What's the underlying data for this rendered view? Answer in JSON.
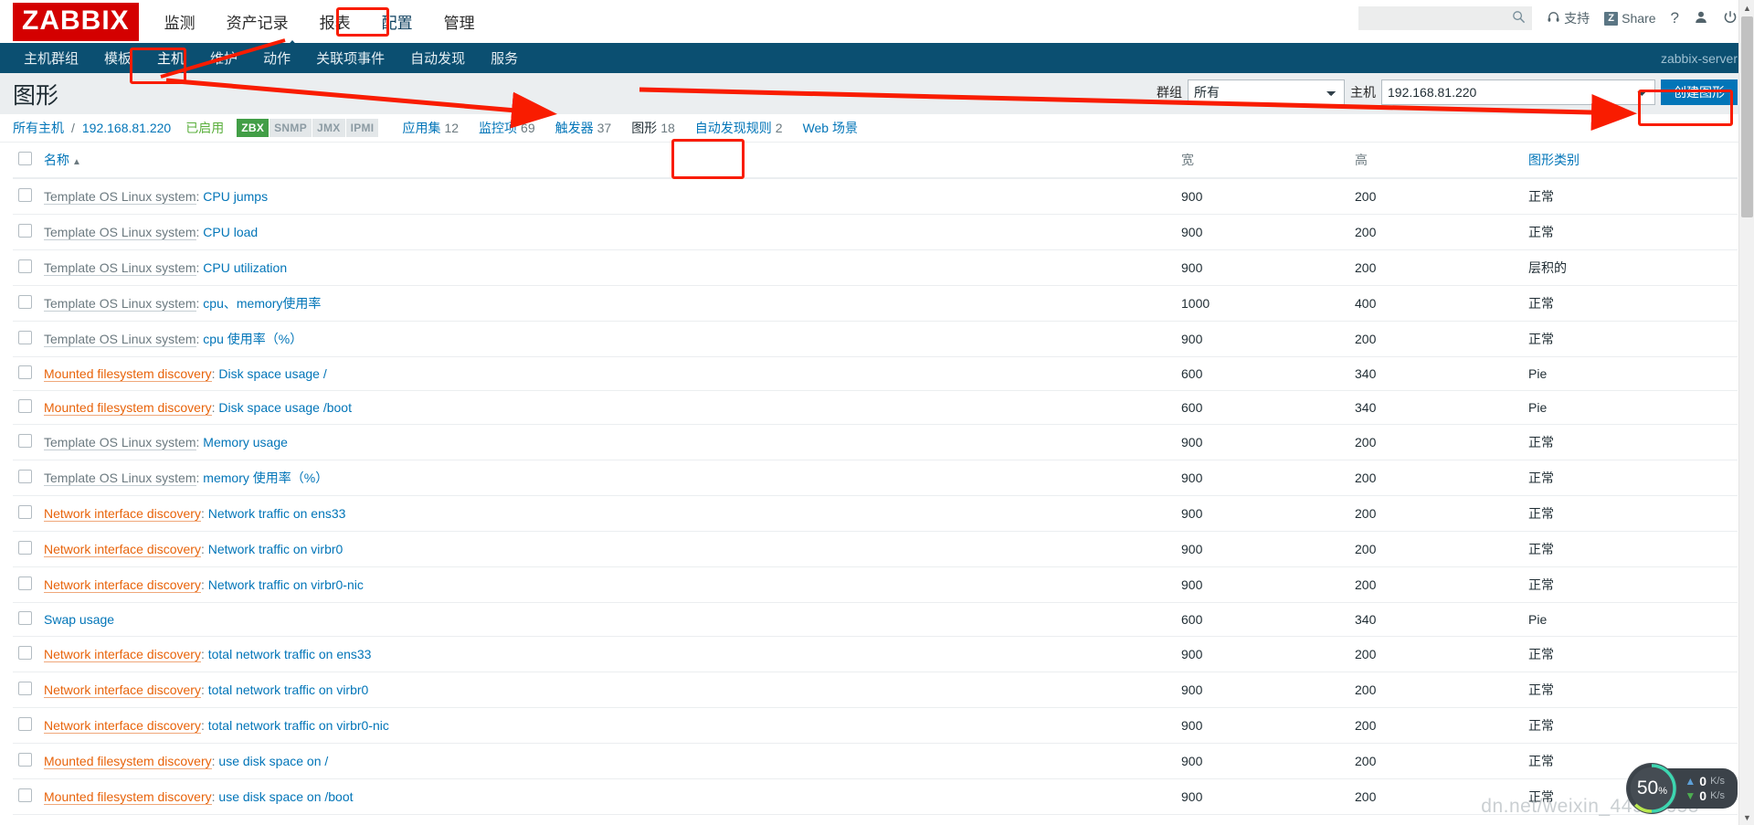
{
  "brand": {
    "logo": "ZABBIX"
  },
  "main_nav": {
    "items": [
      {
        "label": "监测",
        "active": false
      },
      {
        "label": "资产记录",
        "active": false
      },
      {
        "label": "报表",
        "active": false
      },
      {
        "label": "配置",
        "active": true
      },
      {
        "label": "管理",
        "active": false
      }
    ]
  },
  "header_right": {
    "search_placeholder": "",
    "search_value": "",
    "search_icon": "search-icon",
    "support_label": "支持",
    "support_icon": "headset-icon",
    "share_label": "Share",
    "share_badge": "Z",
    "help_icon": "?",
    "user_icon": "user-icon",
    "power_icon": "power-icon"
  },
  "sub_nav": {
    "items": [
      {
        "label": "主机群组",
        "active": false
      },
      {
        "label": "模板",
        "active": false
      },
      {
        "label": "主机",
        "active": true
      },
      {
        "label": "维护",
        "active": false
      },
      {
        "label": "动作",
        "active": false
      },
      {
        "label": "关联项事件",
        "active": false
      },
      {
        "label": "自动发现",
        "active": false
      },
      {
        "label": "服务",
        "active": false
      }
    ],
    "server_label": "zabbix-server"
  },
  "page": {
    "title": "图形"
  },
  "filters": {
    "group_label": "群组",
    "group_value": "所有",
    "host_label": "主机",
    "host_value": "192.168.81.220",
    "create_button": "创建图形"
  },
  "breadcrumb": {
    "all_hosts": "所有主机",
    "separator": "/",
    "host": "192.168.81.220",
    "status": "已启用",
    "badges": [
      {
        "label": "ZBX",
        "active": true
      },
      {
        "label": "SNMP",
        "active": false
      },
      {
        "label": "JMX",
        "active": false
      },
      {
        "label": "IPMI",
        "active": false
      }
    ],
    "tabs": [
      {
        "label": "应用集",
        "count": "12",
        "selected": false
      },
      {
        "label": "监控项",
        "count": "69",
        "selected": false
      },
      {
        "label": "触发器",
        "count": "37",
        "selected": false
      },
      {
        "label": "图形",
        "count": "18",
        "selected": true
      },
      {
        "label": "自动发现规则",
        "count": "2",
        "selected": false
      },
      {
        "label": "Web 场景",
        "count": "",
        "selected": false
      }
    ]
  },
  "table": {
    "headers": {
      "name": "名称",
      "sort_arrow": "▲",
      "width": "宽",
      "height": "高",
      "type": "图形类别"
    },
    "rows": [
      {
        "prefix": "Template OS Linux system",
        "prefix_kind": "template",
        "name": "CPU jumps",
        "width": "900",
        "height": "200",
        "type": "正常"
      },
      {
        "prefix": "Template OS Linux system",
        "prefix_kind": "template",
        "name": "CPU load",
        "width": "900",
        "height": "200",
        "type": "正常"
      },
      {
        "prefix": "Template OS Linux system",
        "prefix_kind": "template",
        "name": "CPU utilization",
        "width": "900",
        "height": "200",
        "type": "层积的"
      },
      {
        "prefix": "Template OS Linux system",
        "prefix_kind": "template",
        "name": "cpu、memory使用率",
        "width": "1000",
        "height": "400",
        "type": "正常"
      },
      {
        "prefix": "Template OS Linux system",
        "prefix_kind": "template",
        "name": "cpu 使用率（%）",
        "width": "900",
        "height": "200",
        "type": "正常"
      },
      {
        "prefix": "Mounted filesystem discovery",
        "prefix_kind": "discovery",
        "name": "Disk space usage /",
        "width": "600",
        "height": "340",
        "type": "Pie"
      },
      {
        "prefix": "Mounted filesystem discovery",
        "prefix_kind": "discovery",
        "name": "Disk space usage /boot",
        "width": "600",
        "height": "340",
        "type": "Pie"
      },
      {
        "prefix": "Template OS Linux system",
        "prefix_kind": "template",
        "name": "Memory usage",
        "width": "900",
        "height": "200",
        "type": "正常"
      },
      {
        "prefix": "Template OS Linux system",
        "prefix_kind": "template",
        "name": "memory 使用率（%）",
        "width": "900",
        "height": "200",
        "type": "正常"
      },
      {
        "prefix": "Network interface discovery",
        "prefix_kind": "discovery",
        "name": "Network traffic on ens33",
        "width": "900",
        "height": "200",
        "type": "正常"
      },
      {
        "prefix": "Network interface discovery",
        "prefix_kind": "discovery",
        "name": "Network traffic on virbr0",
        "width": "900",
        "height": "200",
        "type": "正常"
      },
      {
        "prefix": "Network interface discovery",
        "prefix_kind": "discovery",
        "name": "Network traffic on virbr0-nic",
        "width": "900",
        "height": "200",
        "type": "正常"
      },
      {
        "prefix": "",
        "prefix_kind": "none",
        "name": "Swap usage",
        "width": "600",
        "height": "340",
        "type": "Pie"
      },
      {
        "prefix": "Network interface discovery",
        "prefix_kind": "discovery",
        "name": "total network traffic on ens33",
        "width": "900",
        "height": "200",
        "type": "正常"
      },
      {
        "prefix": "Network interface discovery",
        "prefix_kind": "discovery",
        "name": "total network traffic on virbr0",
        "width": "900",
        "height": "200",
        "type": "正常"
      },
      {
        "prefix": "Network interface discovery",
        "prefix_kind": "discovery",
        "name": "total network traffic on virbr0-nic",
        "width": "900",
        "height": "200",
        "type": "正常"
      },
      {
        "prefix": "Mounted filesystem discovery",
        "prefix_kind": "discovery",
        "name": "use disk space on /",
        "width": "900",
        "height": "200",
        "type": "正常"
      },
      {
        "prefix": "Mounted filesystem discovery",
        "prefix_kind": "discovery",
        "name": "use disk space on /boot",
        "width": "900",
        "height": "200",
        "type": "正常"
      }
    ]
  },
  "float_widget": {
    "cpu_percent": "50",
    "percent_sign": "%",
    "upload_value": "0",
    "upload_unit": "K/s",
    "download_value": "0",
    "download_unit": "K/s"
  },
  "watermark": {
    "text": "dn.net/weixin_44953658"
  },
  "colors": {
    "brand_red": "#d40000",
    "nav_blue": "#0b4f71",
    "link_blue": "#0275b8",
    "discovery_orange": "#e8630a",
    "enabled_green": "#5aaf3c",
    "annotation_red": "#f91c00"
  }
}
